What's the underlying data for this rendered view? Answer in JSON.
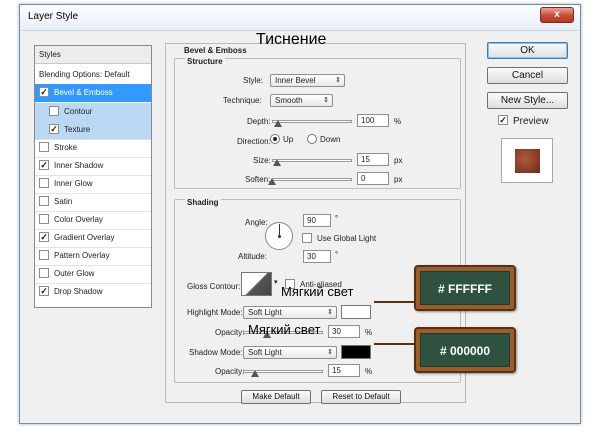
{
  "window": {
    "title": "Layer Style",
    "close_glyph": "x"
  },
  "captions": {
    "embossing": "Тиснение",
    "soft_light_1": "Мягкий свет",
    "soft_light_2": "Мягкий свет"
  },
  "sidebar": {
    "header": "Styles",
    "blending": "Blending Options: Default",
    "items": [
      {
        "label": "Bevel & Emboss",
        "checked": true
      },
      {
        "label": "Contour",
        "checked": false
      },
      {
        "label": "Texture",
        "checked": true
      },
      {
        "label": "Stroke",
        "checked": false
      },
      {
        "label": "Inner Shadow",
        "checked": true
      },
      {
        "label": "Inner Glow",
        "checked": false
      },
      {
        "label": "Satin",
        "checked": false
      },
      {
        "label": "Color Overlay",
        "checked": false
      },
      {
        "label": "Gradient Overlay",
        "checked": true
      },
      {
        "label": "Pattern Overlay",
        "checked": false
      },
      {
        "label": "Outer Glow",
        "checked": false
      },
      {
        "label": "Drop Shadow",
        "checked": true
      }
    ],
    "check_glyph": "✓"
  },
  "bevel": {
    "title": "Bevel & Emboss",
    "structure": {
      "title": "Structure",
      "style_label": "Style:",
      "style_value": "Inner Bevel",
      "technique_label": "Technique:",
      "technique_value": "Smooth",
      "depth_label": "Depth:",
      "depth_value": "100",
      "depth_unit": "%",
      "direction_label": "Direction:",
      "dir_up": "Up",
      "dir_down": "Down",
      "size_label": "Size:",
      "size_value": "15",
      "size_unit": "px",
      "soften_label": "Soften:",
      "soften_value": "0",
      "soften_unit": "px"
    },
    "shading": {
      "title": "Shading",
      "angle_label": "Angle:",
      "angle_value": "90",
      "angle_unit": "°",
      "global_light": "Use Global Light",
      "altitude_label": "Altitude:",
      "altitude_value": "30",
      "altitude_unit": "°",
      "gloss_label": "Gloss Contour:",
      "anti_aliased": "Anti-aliased",
      "highlight_label": "Highlight Mode:",
      "highlight_mode": "Soft Light",
      "highlight_color": "#FFFFFF",
      "highlight_opacity_label": "Opacity:",
      "highlight_opacity": "30",
      "highlight_opacity_unit": "%",
      "shadow_label": "Shadow Mode:",
      "shadow_mode": "Soft Light",
      "shadow_color": "#000000",
      "shadow_opacity_label": "Opacity:",
      "shadow_opacity": "15",
      "shadow_opacity_unit": "%"
    }
  },
  "buttons": {
    "make_default": "Make Default",
    "reset_default": "Reset to Default",
    "ok": "OK",
    "cancel": "Cancel",
    "new_style": "New Style...",
    "preview": "Preview"
  },
  "callouts": {
    "highlight_hex": "# FFFFFF",
    "shadow_hex": "# 000000"
  },
  "sliders": {
    "depth": 0.08,
    "size": 0.06,
    "soften": 0.0,
    "highlight_opacity": 0.3,
    "shadow_opacity": 0.15
  },
  "colors": {
    "accent": "#3399ff",
    "chalkboard": "#2f5240",
    "frame": "#9b5c2e"
  }
}
